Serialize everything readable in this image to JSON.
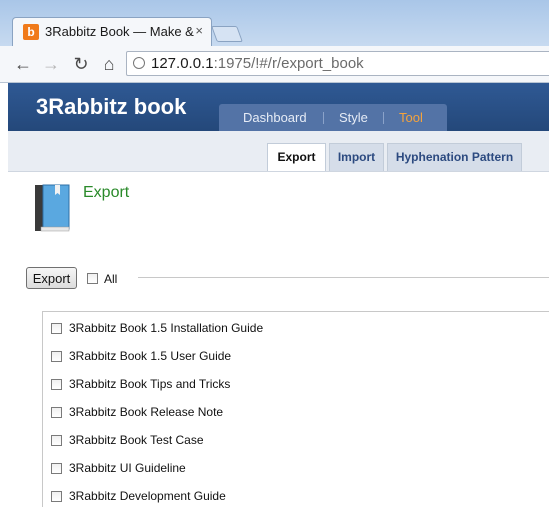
{
  "browser": {
    "tab_title": "3Rabbitz Book — Make &",
    "favicon_letter": "b",
    "close_glyph": "×",
    "url_host": "127.0.0.1",
    "url_rest": ":1975/!#/r/export_book"
  },
  "app": {
    "logo": "3Rabbitz book",
    "main_tabs": [
      "Dashboard",
      "Style",
      "Tool"
    ],
    "active_main_tab": "Tool",
    "sub_tabs": [
      "Export",
      "Import",
      "Hyphenation Pattern"
    ],
    "active_sub_tab": "Export"
  },
  "content": {
    "heading": "Export",
    "export_button": "Export",
    "all_label": "All",
    "documents": [
      "3Rabbitz Book 1.5 Installation Guide",
      "3Rabbitz Book 1.5 User Guide",
      "3Rabbitz Book Tips and Tricks",
      "3Rabbitz Book Release Note",
      "3Rabbitz Book Test Case",
      "3Rabbitz UI Guideline",
      "3Rabbitz Development Guide"
    ]
  },
  "colors": {
    "header_blue": "#2f5994",
    "active_tab_orange": "#f6a33b",
    "heading_green": "#2a8a2a"
  },
  "icons": [
    "back-arrow-icon",
    "forward-arrow-icon",
    "reload-icon",
    "home-icon",
    "page-icon",
    "book-icon"
  ]
}
